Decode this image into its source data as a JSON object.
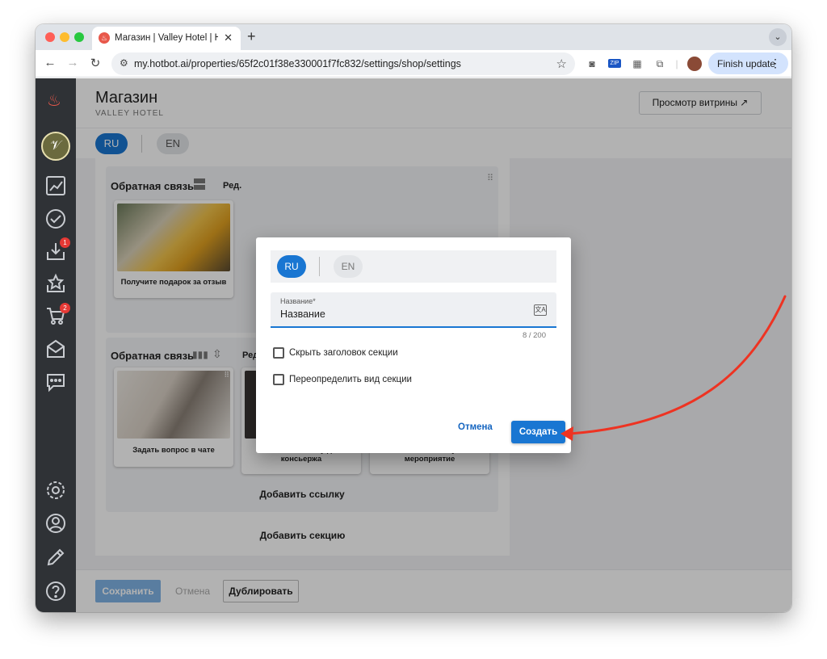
{
  "browser": {
    "tab_title": "Магазин | Valley Hotel | Hotbot",
    "tab_close": "✕",
    "new_tab": "+",
    "url": "my.hotbot.ai/properties/65f2c01f38e330001f7fc832/settings/shop/settings",
    "finish_update": "Finish update"
  },
  "sidebar": {
    "badges": {
      "inbox": "1",
      "cart": "2"
    }
  },
  "header": {
    "title": "Магазин",
    "subtitle": "VALLEY HOTEL",
    "preview_button": "Просмотр витрины ↗"
  },
  "languages": {
    "ru": "RU",
    "en": "EN"
  },
  "sections": [
    {
      "title": "Обратная связь",
      "edit": "Ред.",
      "items": [
        {
          "label": "Получите подарок за отзыв"
        }
      ]
    },
    {
      "title": "Обратная связь",
      "edit": "Ред",
      "items": [
        {
          "label": "Задать вопрос в чате"
        },
        {
          "label": "Оставить заявку для консьержа"
        },
        {
          "label": "Оставить заявку на мероприятие"
        }
      ],
      "add_link": "Добавить ссылку"
    }
  ],
  "add_section": "Добавить секцию",
  "footer": {
    "save": "Сохранить",
    "cancel": "Отмена",
    "duplicate": "Дублировать"
  },
  "dialog": {
    "lang_ru": "RU",
    "lang_en": "EN",
    "field_label": "Название*",
    "field_value": "Название",
    "counter": "8 / 200",
    "checkbox_hide_title": "Скрыть заголовок секции",
    "checkbox_override_view": "Переопределить вид секции",
    "cancel": "Отмена",
    "create": "Создать"
  },
  "colors": {
    "accent": "#1976d2",
    "sidebar": "#2f3236",
    "annotation_arrow": "#ee3322",
    "brand_red": "#e8584b"
  }
}
